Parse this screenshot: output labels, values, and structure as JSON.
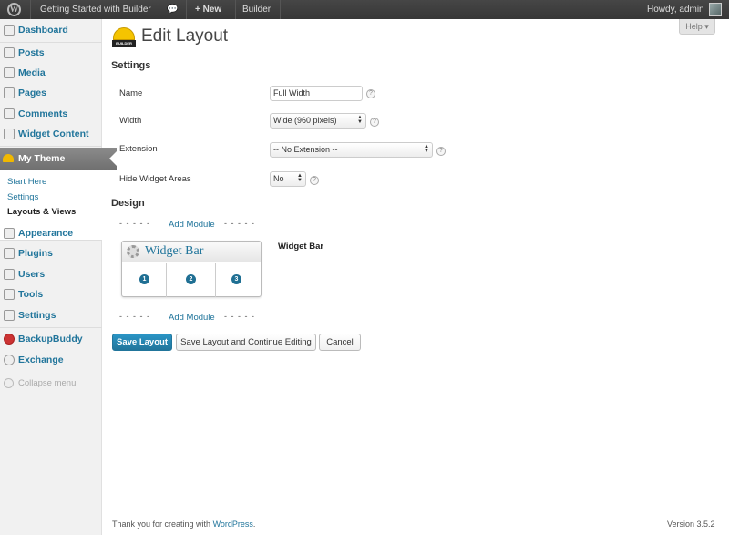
{
  "adminbar": {
    "logo": "W",
    "site_name": "Getting Started with Builder",
    "comments_icon": "comment-bubble-icon",
    "new_label": "+ New",
    "builder_label": "Builder",
    "howdy": "Howdy, admin"
  },
  "sidebar": {
    "items": [
      {
        "label": "Dashboard",
        "icon": "dashboard-icon"
      },
      {
        "label": "Posts",
        "icon": "pin-icon"
      },
      {
        "label": "Media",
        "icon": "media-icon"
      },
      {
        "label": "Pages",
        "icon": "pages-icon"
      },
      {
        "label": "Comments",
        "icon": "comments-icon"
      },
      {
        "label": "Widget Content",
        "icon": "pin-icon"
      },
      {
        "label": "My Theme",
        "icon": "hard-hat-icon"
      },
      {
        "label": "Appearance",
        "icon": "appearance-icon"
      },
      {
        "label": "Plugins",
        "icon": "plugins-icon"
      },
      {
        "label": "Users",
        "icon": "users-icon"
      },
      {
        "label": "Tools",
        "icon": "tools-icon"
      },
      {
        "label": "Settings",
        "icon": "settings-icon"
      },
      {
        "label": "BackupBuddy",
        "icon": "backupbuddy-icon"
      },
      {
        "label": "Exchange",
        "icon": "exchange-icon"
      }
    ],
    "submenu": [
      "Start Here",
      "Settings",
      "Layouts & Views"
    ],
    "collapse": "Collapse menu"
  },
  "main": {
    "title": "Edit Layout",
    "help": "Help ▾",
    "settings_heading": "Settings",
    "fields": {
      "name_label": "Name",
      "name_value": "Full Width",
      "width_label": "Width",
      "width_value": "Wide (960 pixels)",
      "extension_label": "Extension",
      "extension_value": "-- No Extension --",
      "hide_label": "Hide Widget Areas",
      "hide_value": "No"
    },
    "design_heading": "Design",
    "dashes": "- - - - -",
    "add_module": "Add Module",
    "widget": {
      "title": "Widget Bar",
      "columns": [
        "1",
        "2",
        "3"
      ],
      "name": "Widget Bar"
    },
    "buttons": {
      "save": "Save Layout",
      "save_continue": "Save Layout and Continue Editing",
      "cancel": "Cancel"
    }
  },
  "footer": {
    "thanks": "Thank you for creating with ",
    "wordpress": "WordPress",
    "period": ".",
    "version": "Version 3.5.2"
  },
  "colors": {
    "link": "#21759b",
    "primary_button": "#21759b",
    "adminbar_bg": "#464646"
  }
}
